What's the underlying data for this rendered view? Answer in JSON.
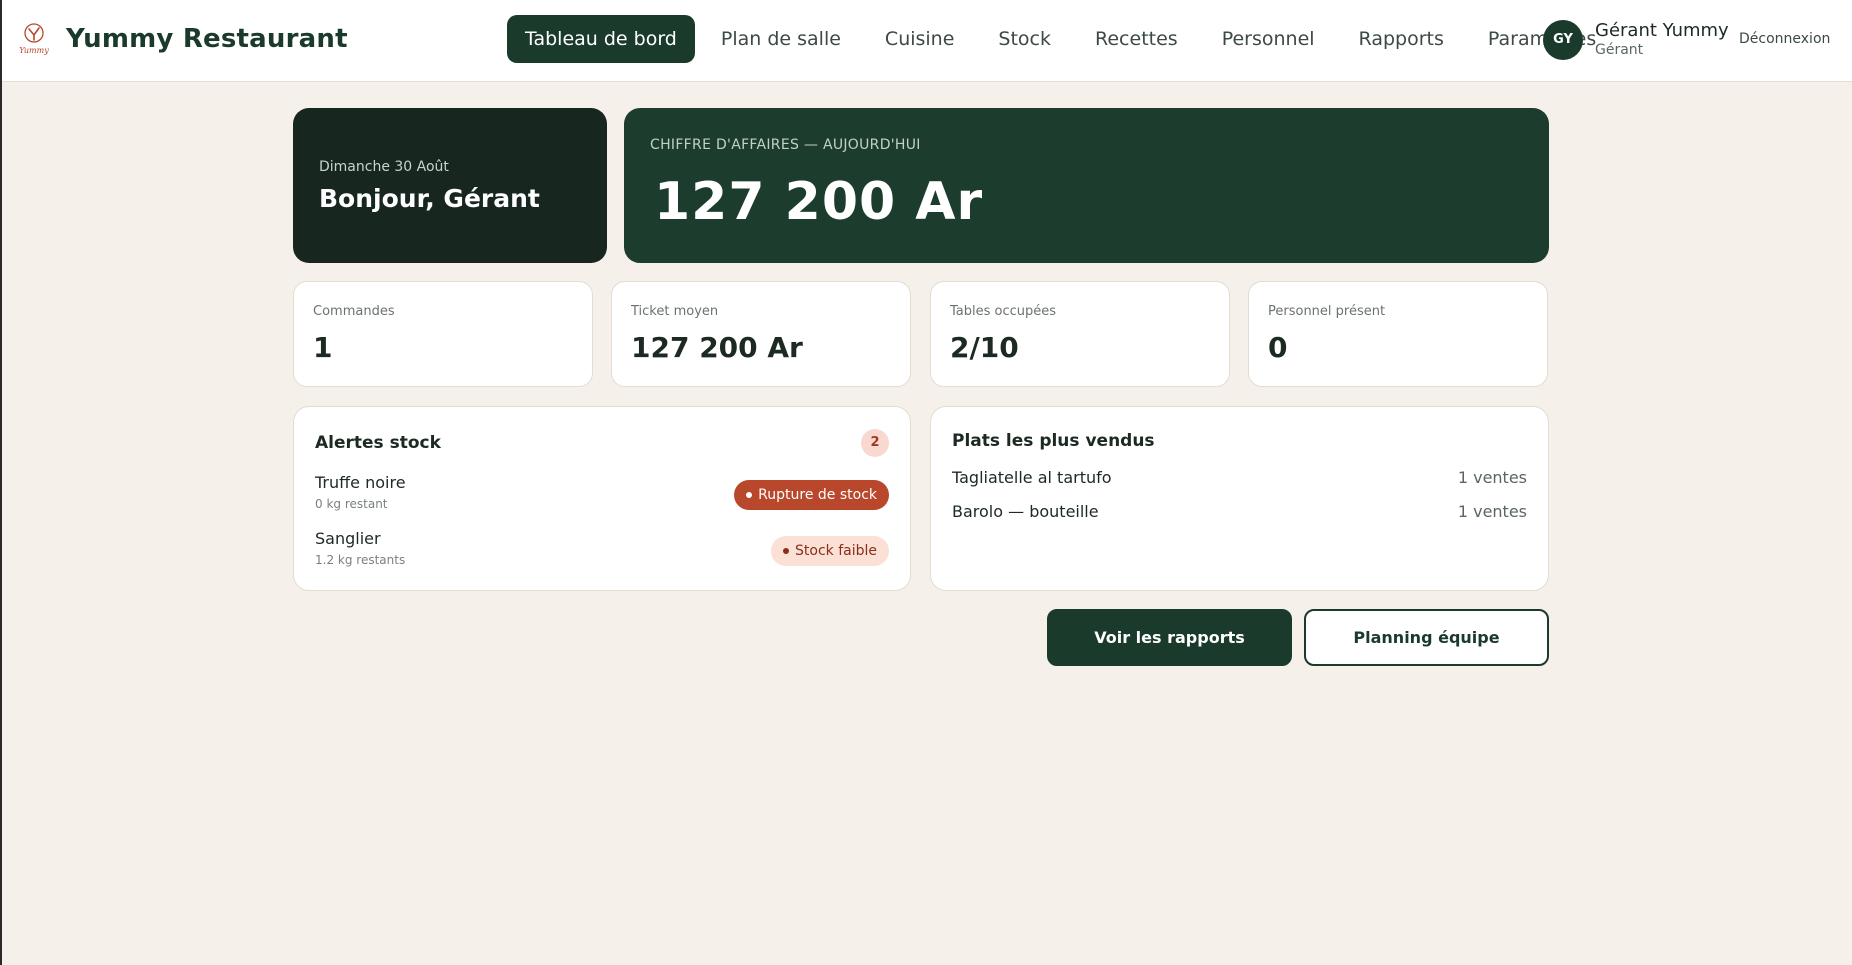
{
  "app": {
    "brand": "Yummy Restaurant",
    "logo_text": "Yummy"
  },
  "nav": {
    "items": [
      {
        "label": "Tableau de bord",
        "active": true
      },
      {
        "label": "Plan de salle",
        "active": false
      },
      {
        "label": "Cuisine",
        "active": false
      },
      {
        "label": "Stock",
        "active": false
      },
      {
        "label": "Recettes",
        "active": false
      },
      {
        "label": "Personnel",
        "active": false
      },
      {
        "label": "Rapports",
        "active": false
      },
      {
        "label": "Paramètres",
        "active": false
      }
    ]
  },
  "user": {
    "initials": "GY",
    "name": "Gérant Yummy",
    "role": "Gérant",
    "logout_label": "Déconnexion"
  },
  "hero": {
    "date": "Dimanche 30 Août",
    "greeting": "Bonjour, Gérant",
    "revenue_label": "CHIFFRE D'AFFAIRES — AUJOURD'HUI",
    "revenue_value": "127 200 Ar"
  },
  "kpis": [
    {
      "label": "Commandes",
      "value": "1"
    },
    {
      "label": "Ticket moyen",
      "value": "127 200 Ar"
    },
    {
      "label": "Tables occupées",
      "value": "2/10"
    },
    {
      "label": "Personnel présent",
      "value": "0"
    }
  ],
  "stock_alerts": {
    "title": "Alertes stock",
    "count": "2",
    "items": [
      {
        "name": "Truffe noire",
        "remaining": "0 kg restant",
        "status": "Rupture de stock"
      },
      {
        "name": "Sanglier",
        "remaining": "1.2 kg restants",
        "status": "Stock faible"
      }
    ]
  },
  "top_dishes": {
    "title": "Plats les plus vendus",
    "items": [
      {
        "name": "Tagliatelle al tartufo",
        "sales": "1 ventes"
      },
      {
        "name": "Barolo — bouteille",
        "sales": "1 ventes"
      }
    ]
  },
  "actions": {
    "reports_label": "Voir les rapports",
    "planning_label": "Planning équipe"
  },
  "colors": {
    "brand_dark": "#1a3a2c",
    "background": "#f5f1ea",
    "danger": "#b8472c",
    "warning_bg": "#fbe0d6"
  }
}
